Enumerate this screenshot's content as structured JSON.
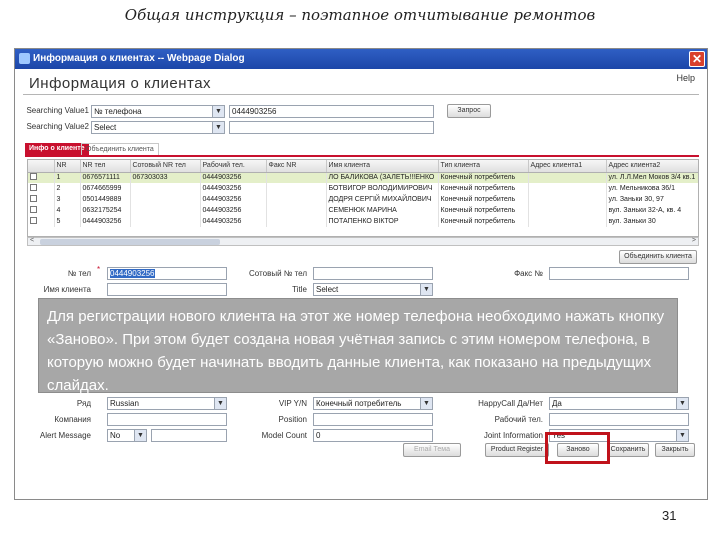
{
  "slide": {
    "title": "Общая инструкция – поэтапное отчитывание ремонтов",
    "page_number": "31"
  },
  "window": {
    "title": "Информация о клиентах -- Webpage Dialog",
    "close_glyph": "✕",
    "heading": "Информация о клиентах",
    "help": "Help"
  },
  "search": {
    "value1_label": "Searching Value1",
    "value1_select": "№ телефона",
    "value1_input": "0444903256",
    "value2_label": "Searching Value2",
    "value2_select": "Select",
    "value2_input": "",
    "search_button": "Запрос"
  },
  "tabs": [
    {
      "label": "Инфо о клиенте"
    },
    {
      "label": "Объединить клиента"
    }
  ],
  "grid": {
    "headers": [
      "",
      "NR",
      "NR тел",
      "Сотовый NR тел",
      "Рабочий тел.",
      "Факс NR",
      "Имя клиента",
      "Тип клиента",
      "Адрес клиента1",
      "Адрес клиента2"
    ],
    "rows": [
      {
        "nr": "1",
        "tel": "0676571111",
        "mobile": "067303033",
        "work": "0444903256",
        "fax": "",
        "name": "ЛО БАЛИКОВА (ЗАЛЕТЬ!!!ЕНКО",
        "type": "Конечный потребитель",
        "addr1": "",
        "addr2": "ул. Л.Л.Мел Моков 3/4 кв.1"
      },
      {
        "nr": "2",
        "tel": "0674665999",
        "mobile": "",
        "work": "0444903256",
        "fax": "",
        "name": "БОТВИГОР ВОЛОДИМИРОВИЧ",
        "type": "Конечный потребитель",
        "addr1": "",
        "addr2": "ул. Мельникова 36/1"
      },
      {
        "nr": "3",
        "tel": "0501449889",
        "mobile": "",
        "work": "0444903256",
        "fax": "",
        "name": "ДОДРЯ СЕРГІЙ МИХАЙЛОВИЧ",
        "type": "Конечный потребитель",
        "addr1": "",
        "addr2": "ул. Заньки 30, 97"
      },
      {
        "nr": "4",
        "tel": "0632175254",
        "mobile": "",
        "work": "0444903256",
        "fax": "",
        "name": "СЕМЕНЮК МАРИНА",
        "type": "Конечный потребитель",
        "addr1": "",
        "addr2": "вул. Заньки 32-А, кв. 4"
      },
      {
        "nr": "5",
        "tel": "0444903256",
        "mobile": "",
        "work": "0444903256",
        "fax": "",
        "name": "ПОТАПЕНКО ВІКТОР",
        "type": "Конечный потребитель",
        "addr1": "",
        "addr2": "вул. Заньки 30"
      }
    ],
    "scroll_left": "<",
    "scroll_right": ">"
  },
  "merge_button": "Объединить клиента",
  "form": {
    "phone_label": "№ тел",
    "phone_value": "0444903256",
    "mobile_label": "Сотовый № тел",
    "mobile_value": "",
    "fax_label": "Факс №",
    "name_label": "Имя клиента",
    "title_label": "Title",
    "title_value": "Select",
    "ryad_label": "Ряд",
    "ryad_value": "Russian",
    "vip_label": "VIP Y/N",
    "vip_value": "Конечный потребитель",
    "happy_label": "HappyCall Да/Нет",
    "happy_value": "Да",
    "company_label": "Компания",
    "position_label": "Position",
    "worktel_label": "Рабочий тел.",
    "alert_label": "Alert Message",
    "alert_value": "No",
    "model_count_label": "Model Count",
    "model_count_value": "0",
    "jointinfo_label": "Joint Information",
    "jointinfo_value": "Yes"
  },
  "bottom_buttons": [
    "Email Тема",
    "Product Register",
    "Заново",
    "Сохранить",
    "Закрыть"
  ],
  "overlay_text": "Для регистрации нового клиента на этот же номер телефона необходимо нажать кнопку «Заново». При этом будет создана новая учётная запись с этим номером телефона, в которую можно будет начинать вводить данные клиента, как показано на предыдущих слайдах.",
  "colors": {
    "titlebar": "#1c46a8",
    "accent_red": "#c8102e",
    "selected_row": "#e4efc9",
    "overlay": "#a0a0a0"
  }
}
